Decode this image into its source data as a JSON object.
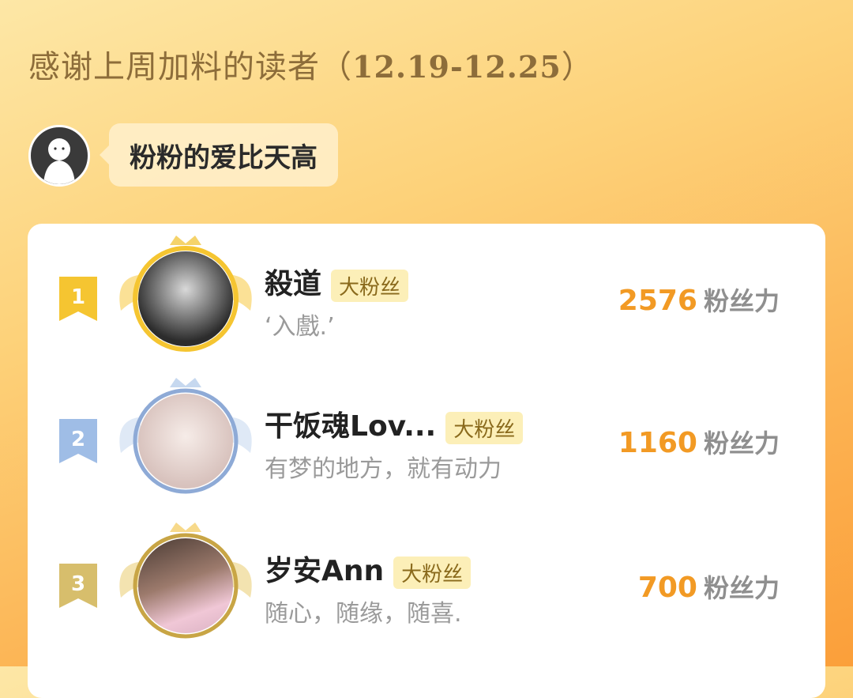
{
  "header": {
    "title_prefix": "感谢上周加料的读者（",
    "title_range": "12.19-12.25",
    "title_suffix": "）"
  },
  "host": {
    "name": "粉粉的爱比天高",
    "avatar_icon": "ghost-avatar"
  },
  "ranking": [
    {
      "rank": "1",
      "name": "殺道",
      "tag": "大粉丝",
      "motto": "‘入戲.’",
      "score": "2576",
      "unit": "粉丝力",
      "color": "#f5c531"
    },
    {
      "rank": "2",
      "name": "干饭魂Lov...",
      "tag": "大粉丝",
      "motto": "有梦的地方，就有动力",
      "score": "1160",
      "unit": "粉丝力",
      "color": "#9fbde6"
    },
    {
      "rank": "3",
      "name": "岁安Ann",
      "tag": "大粉丝",
      "motto": "随心，随缘，随喜.",
      "score": "700",
      "unit": "粉丝力",
      "color": "#d7be6c"
    }
  ],
  "colors": {
    "gold": "#f5c531",
    "silver": "#9fbde6",
    "bronze": "#d7be6c",
    "score": "#f29a24"
  }
}
